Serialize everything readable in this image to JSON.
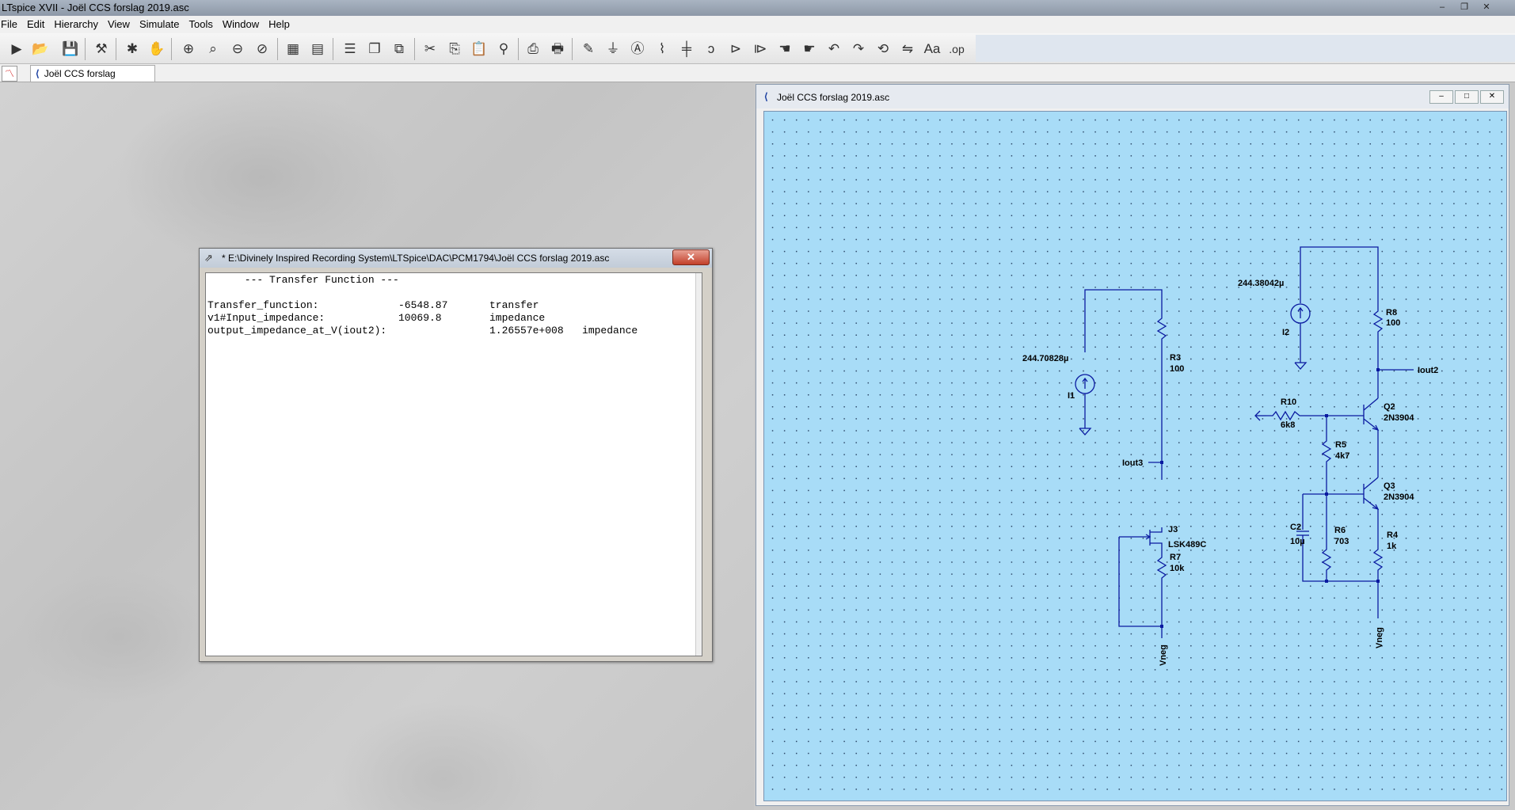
{
  "app": {
    "title": "LTspice XVII - Joël CCS forslag 2019.asc",
    "window_buttons": [
      "–",
      "❐",
      "✕"
    ]
  },
  "menu": [
    "File",
    "Edit",
    "Hierarchy",
    "View",
    "Simulate",
    "Tools",
    "Window",
    "Help"
  ],
  "tabs": [
    {
      "label": "Joël CCS forslag 2019.asc"
    }
  ],
  "netlist_window": {
    "title": "* E:\\Divinely Inspired Recording System\\LTSpice\\DAC\\PCM1794\\Joël CCS forslag 2019.asc",
    "close_label": "✕",
    "header": "      --- Transfer Function ---",
    "rows": [
      {
        "name": "Transfer_function:",
        "value": "-6548.87",
        "unit": "transfer"
      },
      {
        "name": "v1#Input_impedance:",
        "value": "10069.8",
        "unit": "impedance"
      },
      {
        "name": "output_impedance_at_V(iout2):",
        "value": "",
        "unit": "1.26557e+008   impedance"
      }
    ]
  },
  "schematic_window": {
    "title": "Joël CCS forslag 2019.asc",
    "buttons": [
      "–",
      "□",
      "✕"
    ],
    "labels": {
      "i2_value": "244.38042µ",
      "i2_name": "I2",
      "r8_name": "R8",
      "r8_value": "100",
      "iout2": "Iout2",
      "q2_name": "Q2",
      "q2_model": "2N3904",
      "r10_name": "R10",
      "r10_value": "6k8",
      "r5_name": "R5",
      "r5_value": "4k7",
      "q3_name": "Q3",
      "q3_model": "2N3904",
      "c2_name": "C2",
      "c2_value": "10µ",
      "r6_name": "R6",
      "r6_value": "703",
      "r4_name": "R4",
      "r4_value": "1k",
      "vneg_right": "Vneg",
      "i1_value": "244.70828µ",
      "i1_name": "I1",
      "r3_name": "R3",
      "r3_value": "100",
      "iout3": "Iout3",
      "j3_name": "J3",
      "j3_model": "LSK489C",
      "r7_name": "R7",
      "r7_value": "10k",
      "vneg_left": "Vneg"
    }
  }
}
